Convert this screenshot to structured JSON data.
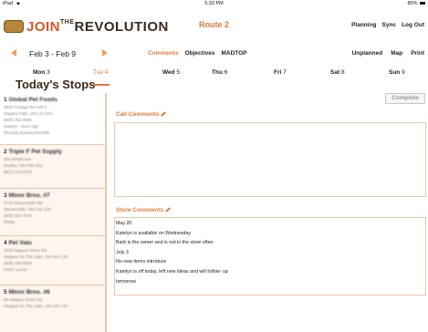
{
  "status": {
    "device": "iPad",
    "time": "5:33 PM",
    "battery": "80%"
  },
  "header": {
    "logo_text_main": "JOIN",
    "logo_text_the": "THE",
    "logo_text_end": "REVOLUTION",
    "route": "Route 2",
    "actions": [
      "Planning",
      "Sync",
      "Log Out"
    ]
  },
  "nav": {
    "week": "Feb 3 - Feb 9",
    "tabs": [
      "Comments",
      "Objectives",
      "MADTOP"
    ],
    "right_tabs": [
      "Unplanned",
      "Map",
      "Print"
    ]
  },
  "days": [
    {
      "name": "Mon",
      "num": "3"
    },
    {
      "name": "Tue",
      "num": "4"
    },
    {
      "name": "Wed",
      "num": "5"
    },
    {
      "name": "Thu",
      "num": "6"
    },
    {
      "name": "Fri",
      "num": "7"
    },
    {
      "name": "Sat",
      "num": "8"
    },
    {
      "name": "Sun",
      "num": "9"
    }
  ],
  "stops_title": "Today's Stops",
  "stops": [
    {
      "num": "1",
      "name": "Global Pet Foods",
      "lines": [
        "3845 Portage Rd Unit 5",
        "Niagara Falls, ON L2J 2K9",
        "(905) 356-3000",
        "Katelyn - store mgr",
        "Rhonda,shawna,Michelle"
      ]
    },
    {
      "num": "2",
      "name": "Triple F Pet Supply",
      "lines": [
        "25a Whyte Ave",
        "Dryden, ON P8N 2Z1",
        "(807) 223-5705"
      ]
    },
    {
      "num": "3",
      "name": "Minor Bros. #7",
      "lines": [
        "2730 Stevensville Rd",
        "Stevensville, ON L0S 1S0",
        "(905) 382-7878",
        "Shelly"
      ]
    },
    {
      "num": "4",
      "name": "Pet Valu",
      "lines": [
        "1520 Niagara Stone Rd",
        "Niagara On The Lake, ON L0S 1J0",
        "(905) 468-8556",
        "Carol, Laurie"
      ]
    },
    {
      "num": "5",
      "name": "Minor Bros. #6",
      "lines": [
        "65 Niagara Stone Rd",
        "Niagara On The Lake, ON L0S 1J0"
      ]
    }
  ],
  "main": {
    "complete_label": "Complete",
    "call_comments_label": "Call Comments",
    "store_comments_label": "Store Comments",
    "store_comments": [
      "May 20",
      "Katelyn is available on Wednesday",
      "Barb is the owner and is not in the store often",
      "July 3",
      "No new items introduce",
      "Katelyn is off today, left new ideas and will follow- up",
      "tomorrow"
    ]
  },
  "colors": {
    "accent": "#e07a3a",
    "brand_dark": "#3b2a1a",
    "border": "#e8c9ad",
    "list_bg": "#fdf5ee"
  }
}
